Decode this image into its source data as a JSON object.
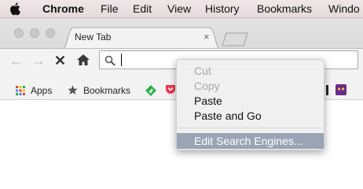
{
  "menubar": {
    "items": [
      {
        "label": "Chrome"
      },
      {
        "label": "File"
      },
      {
        "label": "Edit"
      },
      {
        "label": "View"
      },
      {
        "label": "History"
      },
      {
        "label": "Bookmarks"
      },
      {
        "label": "Windo"
      }
    ]
  },
  "tab": {
    "title": "New Tab",
    "close": "×"
  },
  "toolbar": {
    "back": "←",
    "forward": "→",
    "stop": "✕"
  },
  "omnibox": {
    "value": ""
  },
  "bookmarks": {
    "apps_label": "Apps",
    "bookmarks_label": "Bookmarks"
  },
  "context_menu": {
    "items": [
      {
        "label": "Cut",
        "enabled": false
      },
      {
        "label": "Copy",
        "enabled": false
      },
      {
        "label": "Paste",
        "enabled": true
      },
      {
        "label": "Paste and Go",
        "enabled": true
      },
      {
        "label": "Edit Search Engines...",
        "enabled": true,
        "highlighted": true
      }
    ]
  },
  "colors": {
    "menu_highlight": "#9aa4b4",
    "pocket": "#e8374d",
    "feedly": "#2bb24c",
    "extension": "#6a2a8a"
  }
}
